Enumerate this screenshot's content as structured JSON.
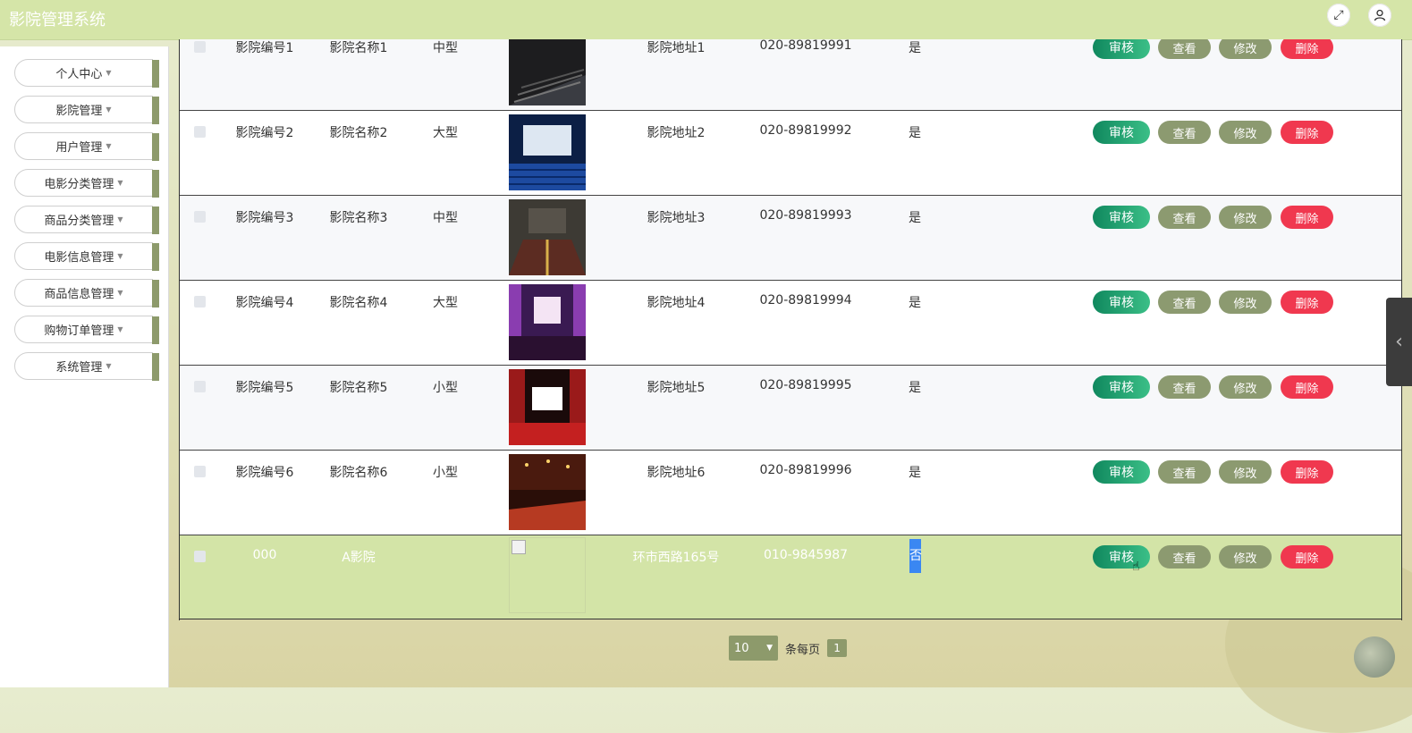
{
  "header": {
    "title": "影院管理系统",
    "icons": [
      "fullscreen-icon",
      "user-icon"
    ]
  },
  "sidebar": {
    "items": [
      {
        "label": "个人中心"
      },
      {
        "label": "影院管理"
      },
      {
        "label": "用户管理"
      },
      {
        "label": "电影分类管理"
      },
      {
        "label": "商品分类管理"
      },
      {
        "label": "电影信息管理"
      },
      {
        "label": "商品信息管理"
      },
      {
        "label": "购物订单管理"
      },
      {
        "label": "系统管理"
      }
    ]
  },
  "table": {
    "actions": {
      "audit": "审核",
      "view": "查看",
      "edit": "修改",
      "delete": "删除"
    },
    "rows": [
      {
        "code": "影院编号1",
        "name": "影院名称1",
        "type": "中型",
        "address": "影院地址1",
        "phone": "020-89819991",
        "status": "是"
      },
      {
        "code": "影院编号2",
        "name": "影院名称2",
        "type": "大型",
        "address": "影院地址2",
        "phone": "020-89819992",
        "status": "是"
      },
      {
        "code": "影院编号3",
        "name": "影院名称3",
        "type": "中型",
        "address": "影院地址3",
        "phone": "020-89819993",
        "status": "是"
      },
      {
        "code": "影院编号4",
        "name": "影院名称4",
        "type": "大型",
        "address": "影院地址4",
        "phone": "020-89819994",
        "status": "是"
      },
      {
        "code": "影院编号5",
        "name": "影院名称5",
        "type": "小型",
        "address": "影院地址5",
        "phone": "020-89819995",
        "status": "是"
      },
      {
        "code": "影院编号6",
        "name": "影院名称6",
        "type": "小型",
        "address": "影院地址6",
        "phone": "020-89819996",
        "status": "是"
      },
      {
        "code": "000",
        "name": "A影院",
        "type": "",
        "address": "环市西路165号",
        "phone": "010-9845987",
        "status": "否"
      }
    ]
  },
  "pagination": {
    "page_size": "10",
    "per_page_label": "条每页",
    "current_page": "1"
  },
  "colors": {
    "header_bg": "#d5e5a8",
    "accent": "#8d9a6b",
    "audit_green": "#10885e",
    "delete_red": "#f0384f",
    "highlight_row": "#d3e4a7"
  }
}
